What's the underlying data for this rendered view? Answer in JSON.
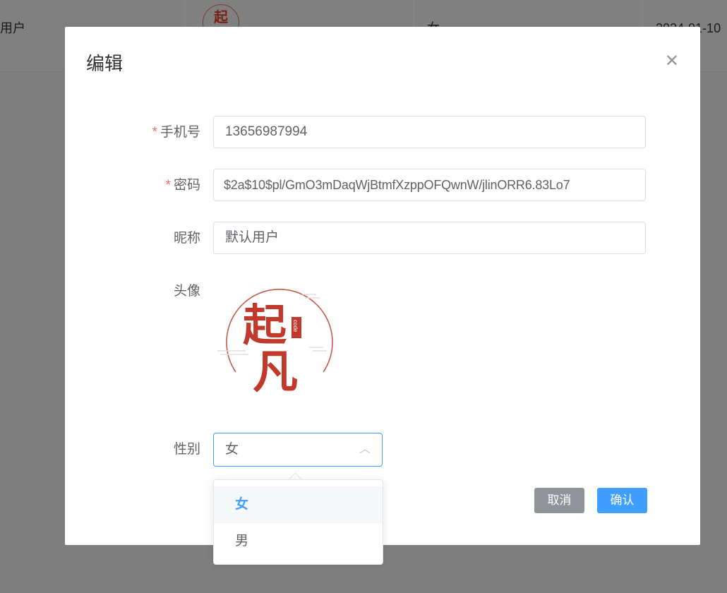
{
  "background_table": {
    "nickname": "用户",
    "gender": "女",
    "date": "2024-01-10"
  },
  "dialog": {
    "title": "编辑",
    "fields": {
      "phone": {
        "label": "手机号",
        "required": true,
        "value": "13656987994"
      },
      "password": {
        "label": "密码",
        "required": true,
        "value": "$2a$10$pl/GmO3mDaqWjBtmfXzppOFQwnW/jlinORR6.83Lo7"
      },
      "nickname": {
        "label": "昵称",
        "value": "默认用户"
      },
      "avatar": {
        "label": "头像",
        "logo_text": "起凡 code"
      },
      "gender": {
        "label": "性别",
        "value": "女"
      }
    },
    "buttons": {
      "cancel": "取消",
      "confirm": "确认"
    }
  },
  "dropdown": {
    "options": [
      "女",
      "男"
    ],
    "selected": "女"
  },
  "colors": {
    "primary": "#409eff",
    "cancel": "#909399",
    "required": "#f56c6c"
  }
}
